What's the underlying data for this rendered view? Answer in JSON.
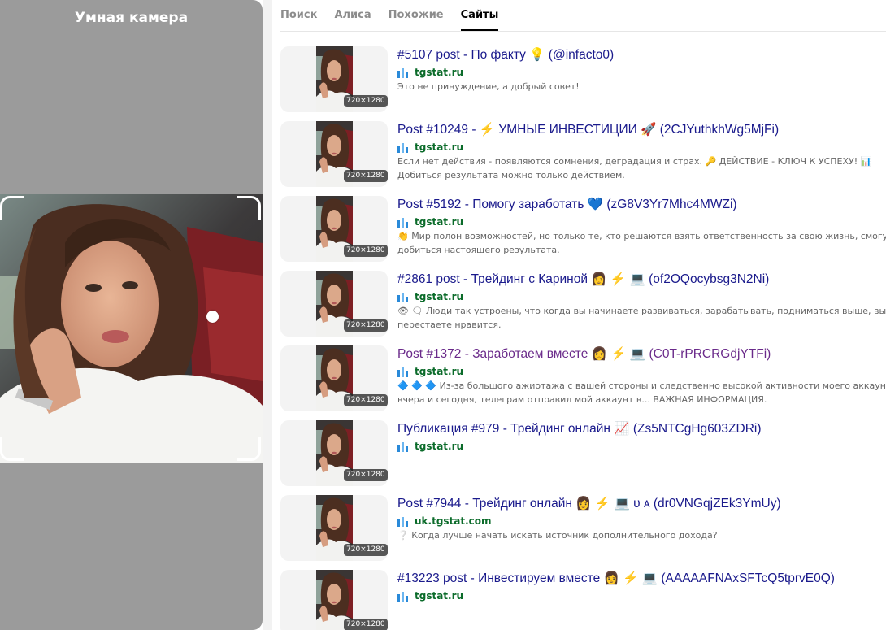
{
  "left_panel": {
    "title": "Умная камера"
  },
  "tabs": [
    {
      "label": "Поиск",
      "active": false
    },
    {
      "label": "Алиса",
      "active": false
    },
    {
      "label": "Похожие",
      "active": false
    },
    {
      "label": "Сайты",
      "active": true
    }
  ],
  "results": [
    {
      "title": "#5107 post - По факту 💡 (@infacto0)",
      "site": "tgstat.ru",
      "size": "720×1280",
      "visited": false,
      "snippet": [
        "Это не принуждение, а добрый совет!"
      ]
    },
    {
      "title": "Post #10249 - ⚡ УМНЫЕ ИНВЕСТИЦИИ 🚀 (2CJYuthkhWg5MjFi)",
      "site": "tgstat.ru",
      "size": "720×1280",
      "visited": false,
      "snippet": [
        "Если нет действия - появляются сомнения, деградация и страх. 🔑 ДЕЙСТВИЕ - КЛЮЧ К УСПЕХУ! 📊",
        "Добиться результата можно только действием."
      ]
    },
    {
      "title": "Post #5192 - Помогу заработать 💙 (zG8V3Yr7Mhc4MWZi)",
      "site": "tgstat.ru",
      "size": "720×1280",
      "visited": false,
      "snippet": [
        "👏 Мир полон возможностей, но только те, кто решаются взять ответственность за свою жизнь, смогу",
        "добиться настоящего результата."
      ]
    },
    {
      "title": "#2861 post - Трейдинг с Кариной 👩 ⚡ 💻 (of2OQocybsg3N2Ni)",
      "site": "tgstat.ru",
      "size": "720×1280",
      "visited": false,
      "snippet": [
        "👁 🗨 Люди так устроены, что когда вы начинаете развиваться, зарабатывать, подниматься выше, вы им",
        "перестаете нравится."
      ]
    },
    {
      "title": "Post #1372 - Заработаем вместе 👩 ⚡ 💻 (C0T-rPRCRGdjYTFi)",
      "site": "tgstat.ru",
      "size": "720×1280",
      "visited": true,
      "snippet": [
        "🔷 🔷 🔷 Из-за большого ажиотажа с вашей стороны и следственно высокой активности моего аккаунт",
        "вчера и сегодня, телеграм отправил мой аккаунт в... ВАЖНАЯ ИНФОРМАЦИЯ."
      ]
    },
    {
      "title": "Публикация #979 - Трейдинг онлайн 📈 (Zs5NTCgHg603ZDRi)",
      "site": "tgstat.ru",
      "size": "720×1280",
      "visited": false,
      "snippet": []
    },
    {
      "title": "Post #7944 - Трейдинг онлайн 👩 ⚡ 💻 ᴜ ᴀ (dr0VNGqjZEk3YmUy)",
      "site": "uk.tgstat.com",
      "size": "720×1280",
      "visited": false,
      "snippet": [
        "❔ Когда лучше начать искать источник дополнительного дохода?"
      ]
    },
    {
      "title": "#13223 post - Инвестируем вместе 👩 ⚡ 💻 (AAAAAFNAxSFTcQ5tprvE0Q)",
      "site": "tgstat.ru",
      "size": "720×1280",
      "visited": false,
      "snippet": []
    }
  ],
  "colors": {
    "link": "#1a1a8c",
    "visited_link": "#6a2a8a",
    "site_green": "#0b6b2a",
    "panel_gray": "#9b9b9b"
  }
}
